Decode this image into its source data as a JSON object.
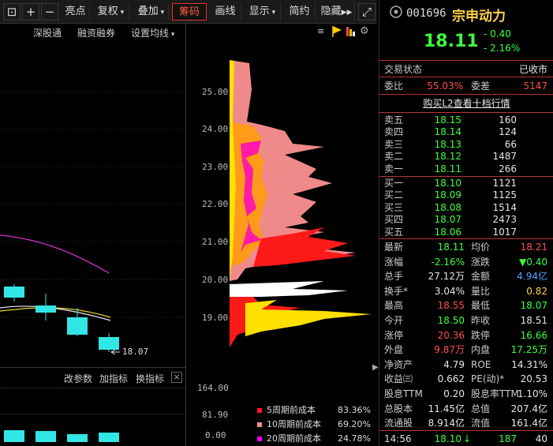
{
  "toolbar": {
    "buttons": [
      "亮点",
      "复权",
      "叠加",
      "筹码",
      "画线",
      "显示",
      "简约",
      "隐藏"
    ],
    "icons": [
      "lock-icon",
      "plus-icon",
      "minus-icon",
      "expand-icon"
    ]
  },
  "subbar": {
    "shengutong": "深股通",
    "rongzi": "融资融券",
    "junxian": "设置均线"
  },
  "price_axis": [
    "25.00",
    "24.00",
    "23.00",
    "22.00",
    "21.00",
    "20.00",
    "19.00"
  ],
  "candle_label": "18.07",
  "indicator_bar": {
    "edit": "改参数",
    "add": "加指标",
    "swap": "换指标",
    "close": "×"
  },
  "volume_axis": [
    "164.00",
    "81.90",
    "0.00"
  ],
  "chip_legend": [
    {
      "label": "5周期前成本",
      "value": "83.36%",
      "color": "#ff1a1a"
    },
    {
      "label": "10周期前成本",
      "value": "69.20%",
      "color": "#ff8c8c"
    },
    {
      "label": "20周期前成本",
      "value": "24.78%",
      "color": "#ff00ff"
    }
  ],
  "quote": {
    "code": "001696",
    "name": "宗申动力",
    "price": "18.11",
    "change": "- 0.40",
    "change_pct": "- 2.16%",
    "status_label": "交易状态",
    "status_value": "已收市",
    "weibi_label": "委比",
    "weibi_value": "55.03%",
    "weicha_label": "委差",
    "weicha_value": "5147",
    "l2_link": "购买L2查看十档行情"
  },
  "order_book": {
    "sell": [
      {
        "label": "卖五",
        "price": "18.15",
        "volume": "160"
      },
      {
        "label": "卖四",
        "price": "18.14",
        "volume": "124"
      },
      {
        "label": "卖三",
        "price": "18.13",
        "volume": "66"
      },
      {
        "label": "卖二",
        "price": "18.12",
        "volume": "1487"
      },
      {
        "label": "卖一",
        "price": "18.11",
        "volume": "266"
      }
    ],
    "buy": [
      {
        "label": "买一",
        "price": "18.10",
        "volume": "1121"
      },
      {
        "label": "买二",
        "price": "18.09",
        "volume": "1125"
      },
      {
        "label": "买三",
        "price": "18.08",
        "volume": "1514"
      },
      {
        "label": "买四",
        "price": "18.07",
        "volume": "2473"
      },
      {
        "label": "买五",
        "price": "18.06",
        "volume": "1017"
      }
    ]
  },
  "stats": [
    {
      "l1": "最新",
      "v1": "18.11",
      "c1": "green",
      "l2": "均价",
      "v2": "18.21",
      "c2": "red"
    },
    {
      "l1": "涨幅",
      "v1": "-2.16%",
      "c1": "green",
      "l2": "涨跌",
      "v2": "▼0.40",
      "c2": "green"
    },
    {
      "l1": "总手",
      "v1": "27.12万",
      "c1": "white",
      "l2": "金额",
      "v2": "4.94亿",
      "c2": "blue"
    },
    {
      "l1": "换手*",
      "v1": "3.04%",
      "c1": "white",
      "l2": "量比",
      "v2": "0.82",
      "c2": "yellow"
    },
    {
      "l1": "最高",
      "v1": "18.55",
      "c1": "red",
      "l2": "最低",
      "v2": "18.07",
      "c2": "green"
    },
    {
      "l1": "今开",
      "v1": "18.50",
      "c1": "green",
      "l2": "昨收",
      "v2": "18.51",
      "c2": "white"
    },
    {
      "l1": "涨停",
      "v1": "20.36",
      "c1": "red",
      "l2": "跌停",
      "v2": "16.66",
      "c2": "green"
    },
    {
      "l1": "外盘",
      "v1": "9.87万",
      "c1": "red",
      "l2": "内盘",
      "v2": "17.25万",
      "c2": "green"
    },
    {
      "l1": "净资产",
      "v1": "4.79",
      "c1": "white",
      "l2": "ROE",
      "v2": "14.31%",
      "c2": "white"
    },
    {
      "l1": "收益㈢",
      "v1": "0.662",
      "c1": "white",
      "l2": "PE(动)*",
      "v2": "20.53",
      "c2": "white"
    },
    {
      "l1": "股息TTM",
      "v1": "0.20",
      "c1": "white",
      "l2": "股息率TTM",
      "v2": "1.10%",
      "c2": "white"
    },
    {
      "l1": "总股本",
      "v1": "11.45亿",
      "c1": "white",
      "l2": "总值",
      "v2": "207.4亿",
      "c2": "white"
    },
    {
      "l1": "流通股",
      "v1": "8.914亿",
      "c1": "white",
      "l2": "流值",
      "v2": "161.4亿",
      "c2": "white"
    }
  ],
  "tick": {
    "time": "14:56",
    "price": "18.10",
    "volume": "187",
    "count": "40"
  }
}
